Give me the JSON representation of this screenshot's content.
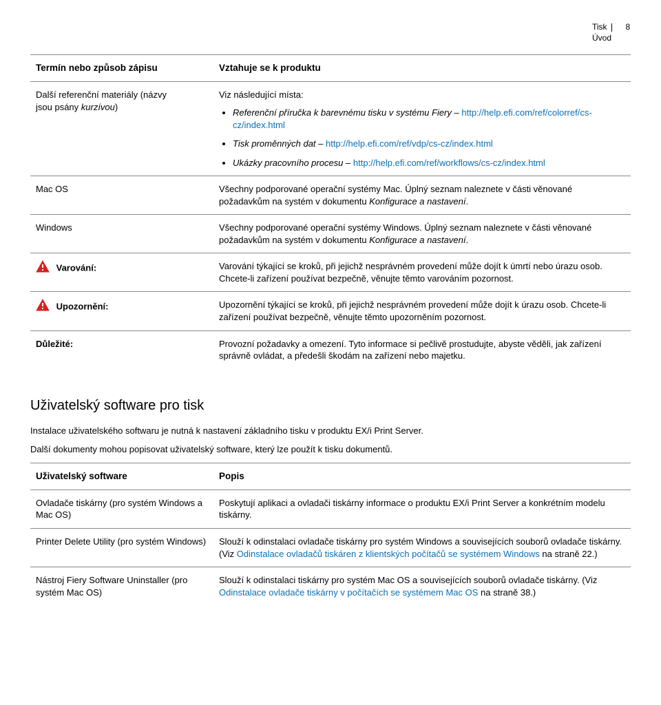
{
  "header": {
    "title": "Tisk",
    "subtitle": "Úvod",
    "page_number": "8"
  },
  "tables": {
    "conventions": {
      "col1_header": "Termín nebo způsob zápisu",
      "col2_header": "Vztahuje se k produktu",
      "rows": {
        "refs": {
          "label_line1": "Další referenční materiály (názvy",
          "label_line2": "jsou psány ",
          "label_italic": "kurzívou",
          "label_line2_end": ")",
          "intro": "Viz následující místa:",
          "bullets": [
            {
              "ital": "Referenční příručka k barevnému tisku v systému Fiery",
              "sep": " – ",
              "link": "http://help.efi.com/ref/colorref/cs-cz/index.html"
            },
            {
              "ital": "Tisk proměnných dat",
              "sep": " – ",
              "link": "http://help.efi.com/ref/vdp/cs-cz/index.html"
            },
            {
              "ital": "Ukázky pracovního procesu",
              "sep": " – ",
              "link": "http://help.efi.com/ref/workflows/cs-cz/index.html"
            }
          ]
        },
        "macos": {
          "label": "Mac OS",
          "text_a": "Všechny podporované operační systémy Mac. Úplný seznam naleznete v části věnované požadavkům na systém v dokumentu ",
          "text_ital": "Konfigurace a nastavení",
          "text_b": "."
        },
        "windows": {
          "label": "Windows",
          "text_a": "Všechny podporované operační systémy Windows. Úplný seznam naleznete v části věnované požadavkům na systém v dokumentu ",
          "text_ital": "Konfigurace a nastavení",
          "text_b": "."
        },
        "warning": {
          "label": "Varování:",
          "text": "Varování týkající se kroků, při jejichž nesprávném provedení může dojít k úmrtí nebo úrazu osob. Chcete-li zařízení používat bezpečně, věnujte těmto varováním pozornost."
        },
        "caution": {
          "label": "Upozornění:",
          "text": "Upozornění týkající se kroků, při jejichž nesprávném provedení může dojít k úrazu osob. Chcete-li zařízení používat bezpečně, věnujte těmto upozorněním pozornost."
        },
        "important": {
          "label": "Důležité:",
          "text": "Provozní požadavky a omezení. Tyto informace si pečlivě prostudujte, abyste věděli, jak zařízení správně ovládat, a předešli škodám na zařízení nebo majetku."
        }
      }
    },
    "software": {
      "col1_header": "Uživatelský software",
      "col2_header": "Popis",
      "rows": {
        "drivers": {
          "label": "Ovladače tiskárny (pro systém Windows a Mac OS)",
          "text": "Poskytují aplikaci a ovladači tiskárny informace o produktu EX/i Print Server a konkrétním modelu tiskárny."
        },
        "delete": {
          "label": "Printer Delete Utility (pro systém Windows)",
          "text_a": "Slouží k odinstalaci ovladače tiskárny pro systém Windows a souvisejících souborů ovladače tiskárny. (Viz ",
          "link": "Odinstalace ovladačů tiskáren z klientských počítačů se systémem Windows",
          "text_b": " na straně 22.)"
        },
        "uninstaller": {
          "label": "Nástroj Fiery Software Uninstaller (pro systém Mac OS)",
          "text_a": "Slouží k odinstalaci tiskárny pro systém Mac OS a souvisejících souborů ovladače tiskárny. (Viz ",
          "link": "Odinstalace ovladače tiskárny v počítačích se systémem Mac OS",
          "text_b": " na straně 38.)"
        }
      }
    }
  },
  "section": {
    "heading": "Uživatelský software pro tisk",
    "p1": "Instalace uživatelského softwaru je nutná k nastavení základního tisku v produktu EX/i Print Server.",
    "p2": "Další dokumenty mohou popisovat uživatelský software, který lze použít k tisku dokumentů."
  }
}
